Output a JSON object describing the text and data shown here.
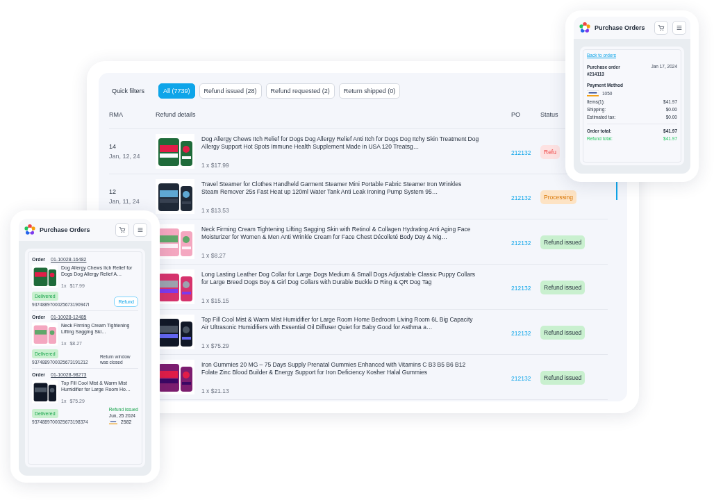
{
  "main": {
    "quick_filters": {
      "label": "Quick filters",
      "chips": [
        {
          "label": "All (7739)",
          "selected": true
        },
        {
          "label": "Refund issued (28)",
          "selected": false
        },
        {
          "label": "Refund requested (2)",
          "selected": false
        },
        {
          "label": "Return shipped (0)",
          "selected": false
        }
      ]
    },
    "table": {
      "columns": [
        "RMA",
        "Refund details",
        "PO",
        "Status"
      ],
      "rows": [
        {
          "rma": "14",
          "date": "Jan, 12, 24",
          "title": "Dog Allergy Chews Itch Relief for Dogs Dog Allergy Relief Anti Itch for Dogs Dog Itchy Skin Treatment Dog Allergy Support Hot Spots Immune Health Supplement Made in USA 120 Treatsg…",
          "qty": "1 x $17.99",
          "po": "212132",
          "status": {
            "text": "Refu",
            "kind": "alert"
          }
        },
        {
          "rma": "12",
          "date": "Jan, 11, 24",
          "title": "Travel Steamer for Clothes Handheld Garment Steamer Mini Portable Fabric Steamer Iron Wrinkles Steam Remover 25s Fast Heat up 120ml Water Tank Anti Leak Ironing Pump System 95…",
          "qty": "1 x $13.53",
          "po": "212132",
          "status": {
            "text": "Processing",
            "kind": "processing"
          }
        },
        {
          "title": "Neck Firming Cream Tightening Lifting Sagging Skin with Retinol & Collagen Hydrating Anti Aging Face Moisturizer for Women & Men Anti Wrinkle Cream for Face Chest Décolleté Body Day & Nig…",
          "qty": "1 x $8.27",
          "po": "212132",
          "status": {
            "text": "Refund issued",
            "kind": "done"
          }
        },
        {
          "title": "Long Lasting Leather Dog Collar for Large Dogs Medium & Small Dogs Adjustable Classic Puppy Collars for Large Breed Dogs Boy & Girl Dog Collars with Durable Buckle D Ring & QR Dog Tag",
          "qty": "1 x $15.15",
          "po": "212132",
          "status": {
            "text": "Refund issued",
            "kind": "done"
          }
        },
        {
          "title": "Top Fill Cool Mist & Warm Mist Humidifier for Large Room Home Bedroom Living Room 6L Big Capacity Air Ultrasonic Humidifiers with Essential Oil Diffuser Quiet for Baby Good for Asthma a…",
          "qty": "1 x $75.29",
          "po": "212132",
          "status": {
            "text": "Refund issued",
            "kind": "done"
          }
        },
        {
          "title": "Iron Gummies 20 MG – 75 Days Supply Prenatal Gummies Enhanced with Vitamins C B3 B5 B6 B12 Folate Zinc Blood Builder & Energy Support for Iron Deficiency Kosher Halal Gummies",
          "qty": "1 x $21.13",
          "po": "212132",
          "status": {
            "text": "Refund issued",
            "kind": "done"
          }
        }
      ]
    }
  },
  "mobile_list": {
    "title": "Purchase Orders",
    "orders": [
      {
        "label": "Order",
        "number": "01-10028-16482",
        "title": "Dog Allergy Chews Itch Relief for Dogs Dog Allergy Relief A…",
        "qty": "1x",
        "price": "$17.99",
        "status": "Delivered",
        "tracking": "9374889700025673190947I",
        "action": {
          "kind": "button",
          "text": "Refund"
        }
      },
      {
        "label": "Order",
        "number": "01-10028-12485",
        "title": "Neck Firming Cream Tightening Lifting Sagging Ski…",
        "qty": "1x",
        "price": "$8.27",
        "status": "Delivered",
        "tracking": "9374889700025673191212",
        "action": {
          "kind": "note",
          "text": "Return window was closed"
        }
      },
      {
        "label": "Order",
        "number": "01-10028-98273",
        "title": "Top Fill Cool Mist & Warm Mist Humidifier for Large Room Ho…",
        "qty": "1x",
        "price": "$75.29",
        "status": "Delivered",
        "tracking": "9374889700025673198374",
        "action": {
          "kind": "refund",
          "text": "Refund issued",
          "date": "Jun, 25 2024",
          "card": "2582"
        }
      }
    ]
  },
  "mobile_detail": {
    "title": "Purchase Orders",
    "back_link": "Back to orders",
    "order_label": "Purchase order #214113",
    "date": "Jan 17, 2024",
    "payment_label": "Payment Method",
    "card": "1050",
    "lines": [
      {
        "label": "Items(1):",
        "value": "$41.97"
      },
      {
        "label": "Shipping:",
        "value": "$0.00"
      },
      {
        "label": "Estimated tax:",
        "value": "$0.00"
      }
    ],
    "totals": [
      {
        "label": "Order total:",
        "value": "$41.97",
        "kind": "order"
      },
      {
        "label": "Refund total:",
        "value": "$41.97",
        "kind": "refund"
      }
    ]
  }
}
